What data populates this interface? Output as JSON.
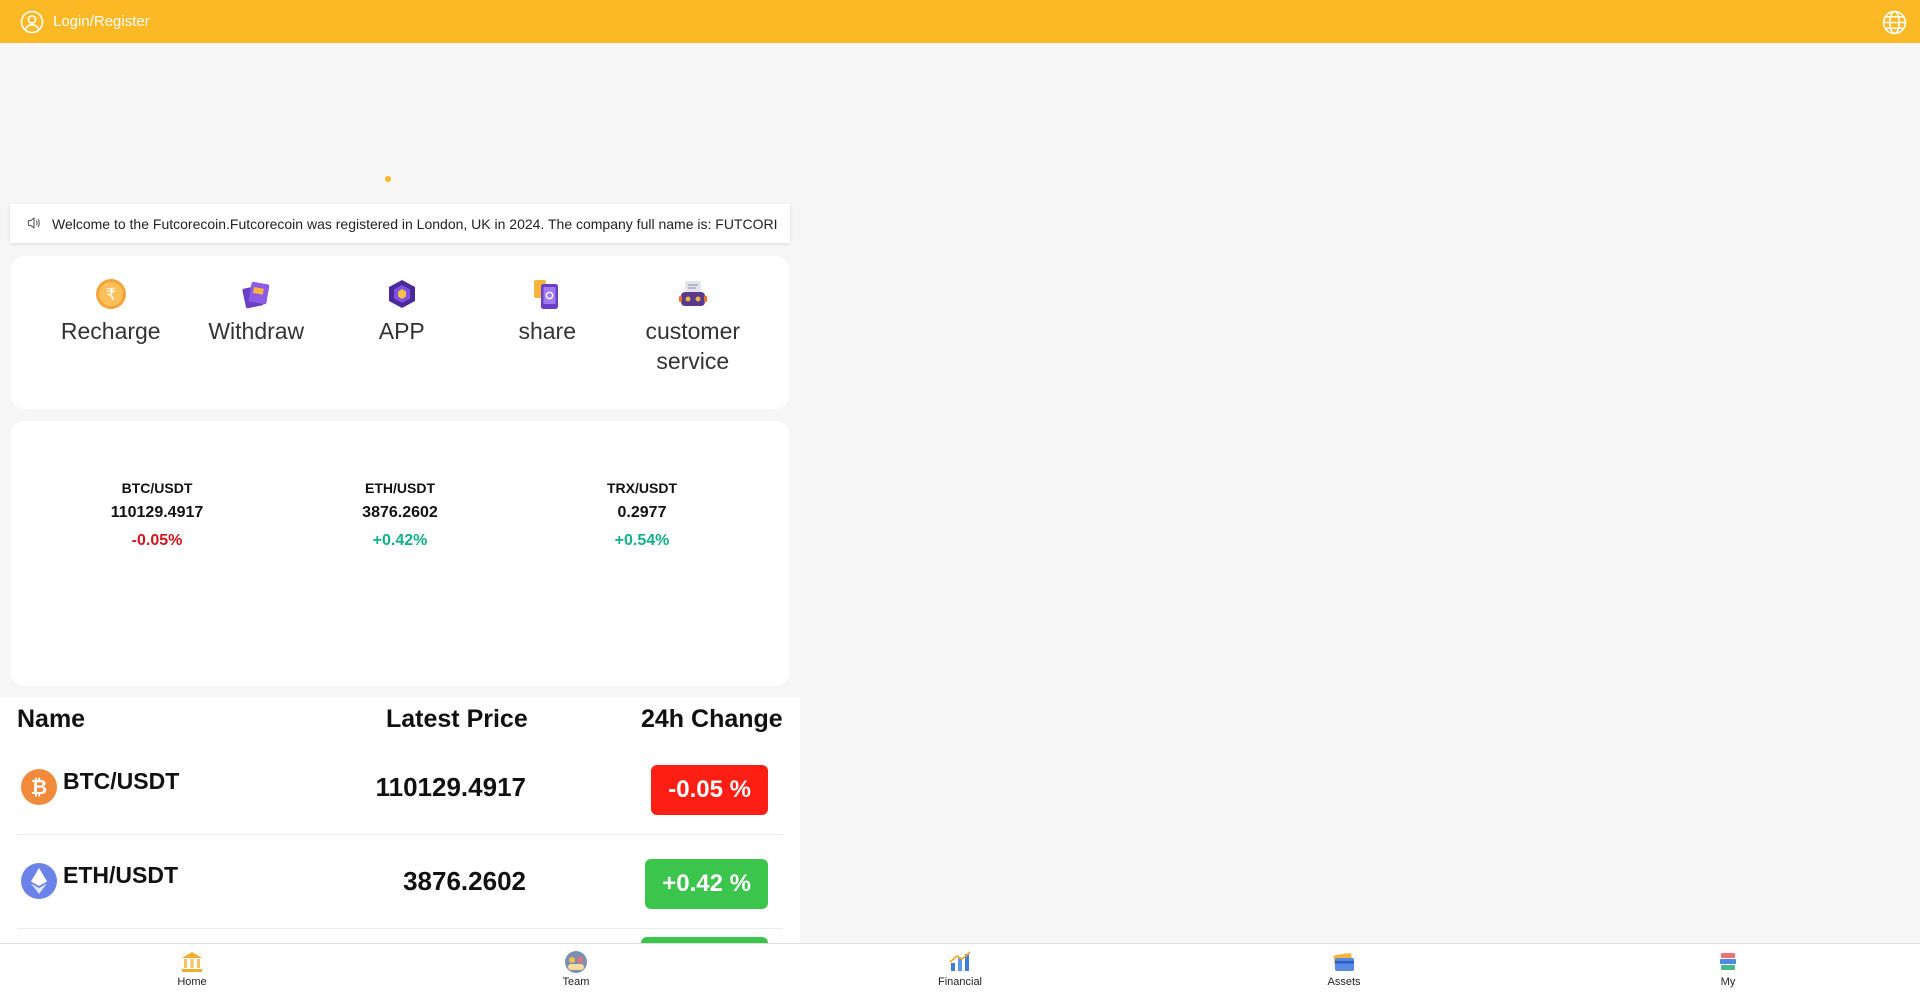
{
  "header": {
    "login_label": "Login/Register"
  },
  "notice": {
    "text": "Welcome to the Futcorecoin.Futcorecoin was registered in London, UK in 2024. The company full name is: FUTCORI"
  },
  "actions": [
    {
      "label": "Recharge",
      "icon": "rupee-coin-icon"
    },
    {
      "label": "Withdraw",
      "icon": "cards-icon"
    },
    {
      "label": "APP",
      "icon": "cube-icon"
    },
    {
      "label": "share",
      "icon": "phone-icon"
    },
    {
      "label": "customer service",
      "icon": "robot-icon"
    }
  ],
  "tickers": [
    {
      "pair": "BTC/USDT",
      "price": "110129.4917",
      "change": "-0.05%"
    },
    {
      "pair": "ETH/USDT",
      "price": "3876.2602",
      "change": "+0.42%"
    },
    {
      "pair": "TRX/USDT",
      "price": "0.2977",
      "change": "+0.54%"
    }
  ],
  "market": {
    "columns": {
      "name": "Name",
      "price": "Latest Price",
      "change": "24h Change"
    },
    "rows": [
      {
        "name": "BTC/USDT",
        "price": "110129.4917",
        "change": "-0.05 %"
      },
      {
        "name": "ETH/USDT",
        "price": "3876.2602",
        "change": "+0.42 %"
      }
    ]
  },
  "tabs": [
    {
      "label": "Home",
      "icon": "bank-icon"
    },
    {
      "label": "Team",
      "icon": "team-icon"
    },
    {
      "label": "Financial",
      "icon": "chart-icon"
    },
    {
      "label": "Assets",
      "icon": "wallet-icon"
    },
    {
      "label": "My",
      "icon": "books-icon"
    }
  ],
  "colors": {
    "primary": "#fdb826",
    "negative": "#ff1e14",
    "positive": "#3cc54d",
    "ticker_negative": "#d3131c",
    "ticker_positive": "#10b08b"
  }
}
